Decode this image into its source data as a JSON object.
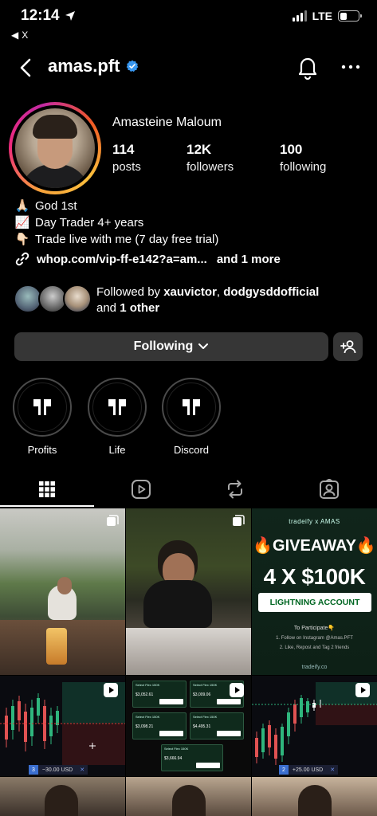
{
  "status_bar": {
    "time": "12:14",
    "back_app": "X",
    "network": "LTE"
  },
  "header": {
    "username": "amas.pft"
  },
  "profile": {
    "full_name": "Amasteine Maloum",
    "stats": [
      {
        "value": "114",
        "label": "posts"
      },
      {
        "value": "12K",
        "label": "followers"
      },
      {
        "value": "100",
        "label": "following"
      }
    ],
    "bio": [
      {
        "emoji": "🙏🏻",
        "text": "God 1st"
      },
      {
        "emoji": "📈",
        "text": "Day Trader 4+ years"
      },
      {
        "emoji": "👇🏻",
        "text": "Trade live with me (7 day free trial)"
      }
    ],
    "link": "whop.com/vip-ff-e142?a=am...",
    "link_more": "and 1 more"
  },
  "followed_by": {
    "prefix": "Followed by",
    "user1": "xauvictor",
    "separator": ",",
    "user2": "dodgysddofficial",
    "and": "and",
    "other": "1 other"
  },
  "actions": {
    "following_label": "Following"
  },
  "highlights": [
    {
      "label": "Profits"
    },
    {
      "label": "Life"
    },
    {
      "label": "Discord"
    }
  ],
  "tabs": [
    {
      "name": "grid-icon"
    },
    {
      "name": "reels-icon"
    },
    {
      "name": "reposts-icon"
    },
    {
      "name": "tagged-icon"
    }
  ],
  "posts": {
    "giveaway": {
      "brand": "tradeify  x  AMAS",
      "title": "🔥GIVEAWAY🔥",
      "amount": "4 X $100K",
      "pill": "LIGHTNING ACCOUNT",
      "participate": "To Participate👇",
      "step1": "1. Follow on Instagram @Amas.PFT",
      "step2": "2. Like, Repost and Tag 2 friends",
      "site": "tradeify.co"
    },
    "trade_left": {
      "num": "3",
      "value": "−30.00 USD",
      "x": "✕"
    },
    "trade_right": {
      "num": "2",
      "value": "+25.00 USD",
      "x": "✕"
    },
    "payout_cards": [
      {
        "title": "Select Flex 150K",
        "amount": "$3,052.61"
      },
      {
        "title": "Select Flex 150K",
        "amount": "$3,009.06"
      },
      {
        "title": "Select Flex 150K",
        "amount": "$3,098.21"
      },
      {
        "title": "Select Flex 150K",
        "amount": "$4,495.31"
      },
      {
        "title": "Select Flex 150K",
        "amount": "$3,666.94"
      }
    ]
  },
  "colors": {
    "accent_verified": "#3897f0",
    "button_bg": "#363636",
    "giveaway_green": "#0d2016"
  }
}
